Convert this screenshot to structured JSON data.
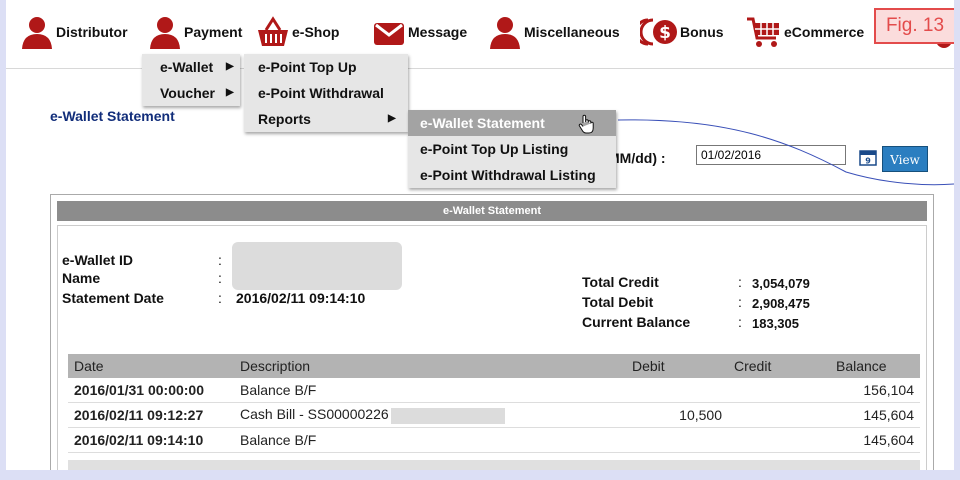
{
  "nav": {
    "items": [
      {
        "label": "Distributor",
        "icon": "person-icon"
      },
      {
        "label": "Payment",
        "icon": "person-icon"
      },
      {
        "label": "e-Shop",
        "icon": "basket-icon"
      },
      {
        "label": "Message",
        "icon": "envelope-icon"
      },
      {
        "label": "Miscellaneous",
        "icon": "person-icon"
      },
      {
        "label": "Bonus",
        "icon": "dollar-coin-icon"
      },
      {
        "label": "eCommerce",
        "icon": "shopping-cart-icon"
      }
    ]
  },
  "figure_label": "Fig. 13",
  "menus": {
    "level1": [
      "e-Wallet",
      "Voucher"
    ],
    "level2": [
      "e-Point Top Up",
      "e-Point Withdrawal",
      "Reports"
    ],
    "level3": [
      "e-Wallet Statement",
      "e-Point Top Up Listing",
      "e-Point Withdrawal Listing"
    ]
  },
  "page_title": "e-Wallet Statement",
  "date_filter": {
    "label": "MM/dd) :",
    "value": "01/02/2016",
    "view_label": "View"
  },
  "panel": {
    "title": "e-Wallet Statement",
    "left_labels": [
      "e-Wallet ID",
      "Name",
      "Statement Date"
    ],
    "statement_date": "2016/02/11 09:14:10",
    "right_labels": [
      "Total Credit",
      "Total Debit",
      "Current Balance"
    ],
    "right_values": [
      "3,054,079",
      "2,908,475",
      "183,305"
    ],
    "colon": ":"
  },
  "table": {
    "headers": [
      "Date",
      "Description",
      "Debit",
      "Credit",
      "Balance"
    ],
    "rows": [
      {
        "date": "2016/01/31 00:00:00",
        "desc": "Balance B/F",
        "debit": "",
        "credit": "",
        "balance": "156,104"
      },
      {
        "date": "2016/02/11 09:12:27",
        "desc": "Cash Bill - SS00000226",
        "debit": "10,500",
        "credit": "",
        "balance": "145,604"
      },
      {
        "date": "2016/02/11 09:14:10",
        "desc": "Balance B/F",
        "debit": "",
        "credit": "",
        "balance": "145,604"
      }
    ]
  },
  "colors": {
    "accent": "#112d7a",
    "button": "#2b7ec0",
    "highlight": "#a3a3a3",
    "fig_border": "#e34b4b",
    "icon": "#b01818"
  }
}
